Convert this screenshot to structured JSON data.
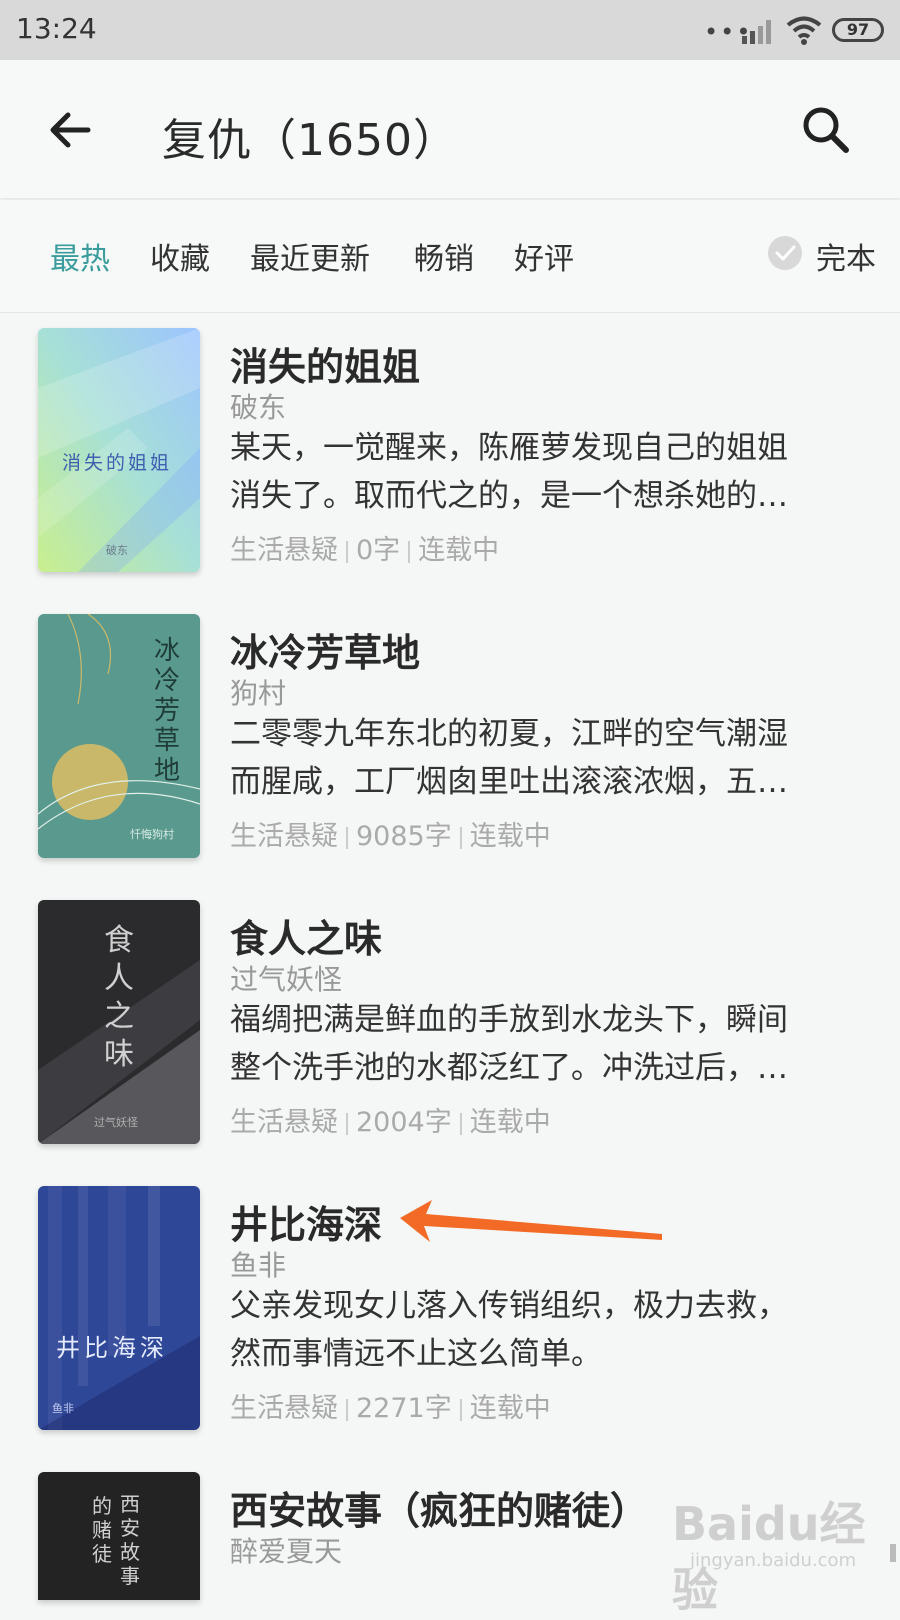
{
  "status_bar": {
    "time": "13:24",
    "battery": "97"
  },
  "header": {
    "title": "复仇（1650）"
  },
  "filters": {
    "tabs": [
      "最热",
      "收藏",
      "最近更新",
      "畅销",
      "好评"
    ],
    "active": "最热",
    "complete_label": "完本"
  },
  "books": [
    {
      "title": "消失的姐姐",
      "author": "破东",
      "desc_line1": "某天，一觉醒来，陈雁萝发现自己的姐姐",
      "desc_line2": "消失了。取而代之的，是一个想杀她的…",
      "category": "生活悬疑",
      "words": "0字",
      "status": "连载中",
      "cover_title": "消失的姐姐",
      "cover_author": "破东"
    },
    {
      "title": "冰冷芳草地",
      "author": "狗村",
      "desc_line1": "二零零九年东北的初夏，江畔的空气潮湿",
      "desc_line2": "而腥咸，工厂烟囱里吐出滚滚浓烟，五…",
      "category": "生活悬疑",
      "words": "9085字",
      "status": "连载中",
      "cover_title": "冰冷芳草地",
      "cover_author": "忏悔狗村"
    },
    {
      "title": "食人之味",
      "author": "过气妖怪",
      "desc_line1": "福绸把满是鲜血的手放到水龙头下，瞬间",
      "desc_line2": "整个洗手池的水都泛红了。冲洗过后，…",
      "category": "生活悬疑",
      "words": "2004字",
      "status": "连载中",
      "cover_title": "食人之味",
      "cover_author": "过气妖怪"
    },
    {
      "title": "井比海深",
      "author": "鱼非",
      "desc_line1": "父亲发现女儿落入传销组织，极力去救，",
      "desc_line2": "然而事情远不止这么简单。",
      "category": "生活悬疑",
      "words": "2271字",
      "status": "连载中",
      "cover_title": "井比海深",
      "cover_author": "鱼非"
    },
    {
      "title": "西安故事（疯狂的赌徒）",
      "author": "醉爱夏天",
      "cover_title_a": "的赌徒",
      "cover_title_b": "西安故事"
    }
  ],
  "watermark": {
    "main": "Baidu经验",
    "sub": "jingyan.baidu.com"
  },
  "colors": {
    "accent": "#3a9c9c",
    "arrow": "#f26a26"
  }
}
